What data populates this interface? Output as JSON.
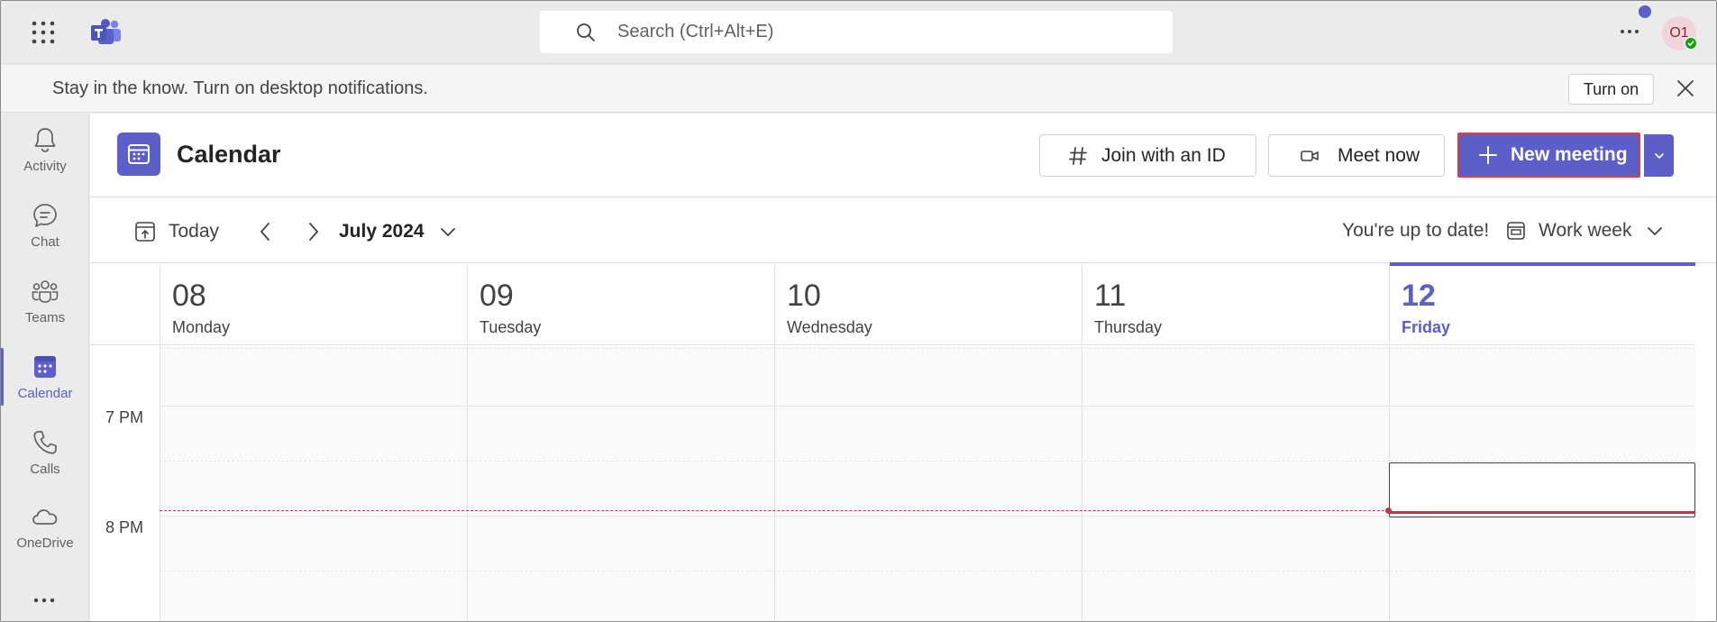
{
  "top_bar": {
    "search_placeholder": "Search (Ctrl+Alt+E)",
    "avatar_initials": "O1"
  },
  "banner": {
    "message": "Stay in the know. Turn on desktop notifications.",
    "turn_on_label": "Turn on"
  },
  "rail": {
    "items": [
      {
        "label": "Activity",
        "icon": "bell-icon"
      },
      {
        "label": "Chat",
        "icon": "chat-icon"
      },
      {
        "label": "Teams",
        "icon": "teams-icon"
      },
      {
        "label": "Calendar",
        "icon": "calendar-icon",
        "active": true
      },
      {
        "label": "Calls",
        "icon": "phone-icon"
      },
      {
        "label": "OneDrive",
        "icon": "cloud-icon"
      }
    ]
  },
  "header": {
    "title": "Calendar",
    "join_label": "Join with an ID",
    "meet_label": "Meet now",
    "new_meeting_label": "New meeting"
  },
  "toolbar": {
    "today_label": "Today",
    "month_label": "July 2024",
    "status_text": "You're up to date!",
    "view_label": "Work week"
  },
  "days": [
    {
      "num": "08",
      "name": "Monday"
    },
    {
      "num": "09",
      "name": "Tuesday"
    },
    {
      "num": "10",
      "name": "Wednesday"
    },
    {
      "num": "11",
      "name": "Thursday"
    },
    {
      "num": "12",
      "name": "Friday",
      "today": true
    }
  ],
  "time_labels": [
    "7 PM",
    "8 PM"
  ],
  "colors": {
    "accent": "#5b5fc7",
    "now_line": "#c4314b",
    "selection_outline": "#e33b3b"
  }
}
